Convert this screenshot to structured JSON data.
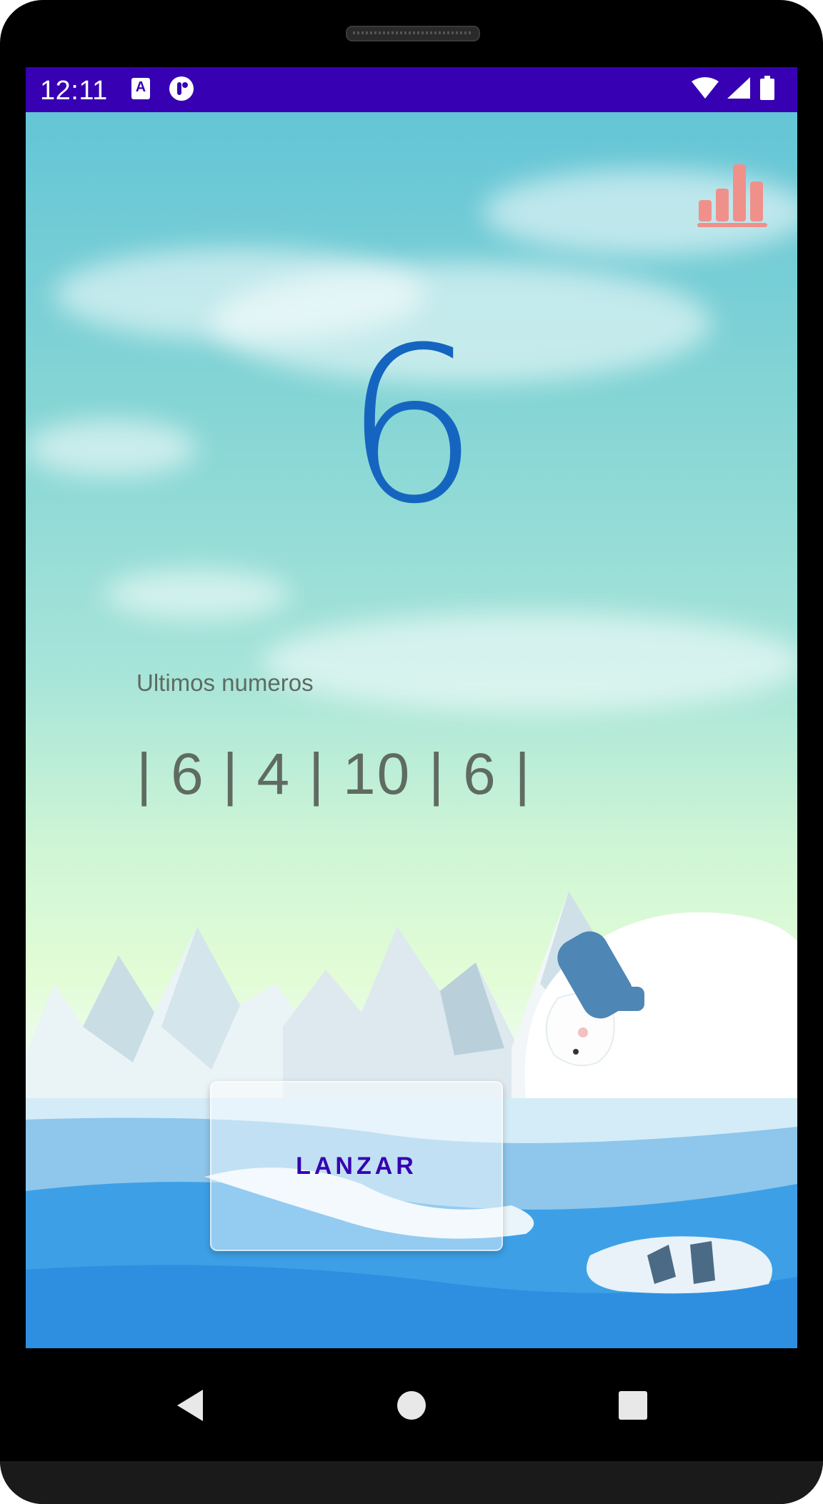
{
  "status_bar": {
    "time": "12:11",
    "left_icons": [
      "text-a-icon",
      "tasker-icon"
    ],
    "right_icons": [
      "wifi-icon",
      "signal-icon",
      "battery-icon"
    ],
    "background": "#3700b3"
  },
  "main": {
    "current_number": "6",
    "last_numbers_label": "Ultimos numeros",
    "last_numbers_text": "| 6 | 4 | 10 | 6 |",
    "stats_icon": "bar-chart-icon",
    "roll_button_label": "LANZAR"
  },
  "nav_bar": {
    "back_icon": "back-triangle-icon",
    "home_icon": "home-circle-icon",
    "recents_icon": "recents-square-icon"
  },
  "colors": {
    "number": "#1565c0",
    "accent": "#3700b3",
    "stats_icon": "#f0908b",
    "label_text": "#5d6b61"
  }
}
